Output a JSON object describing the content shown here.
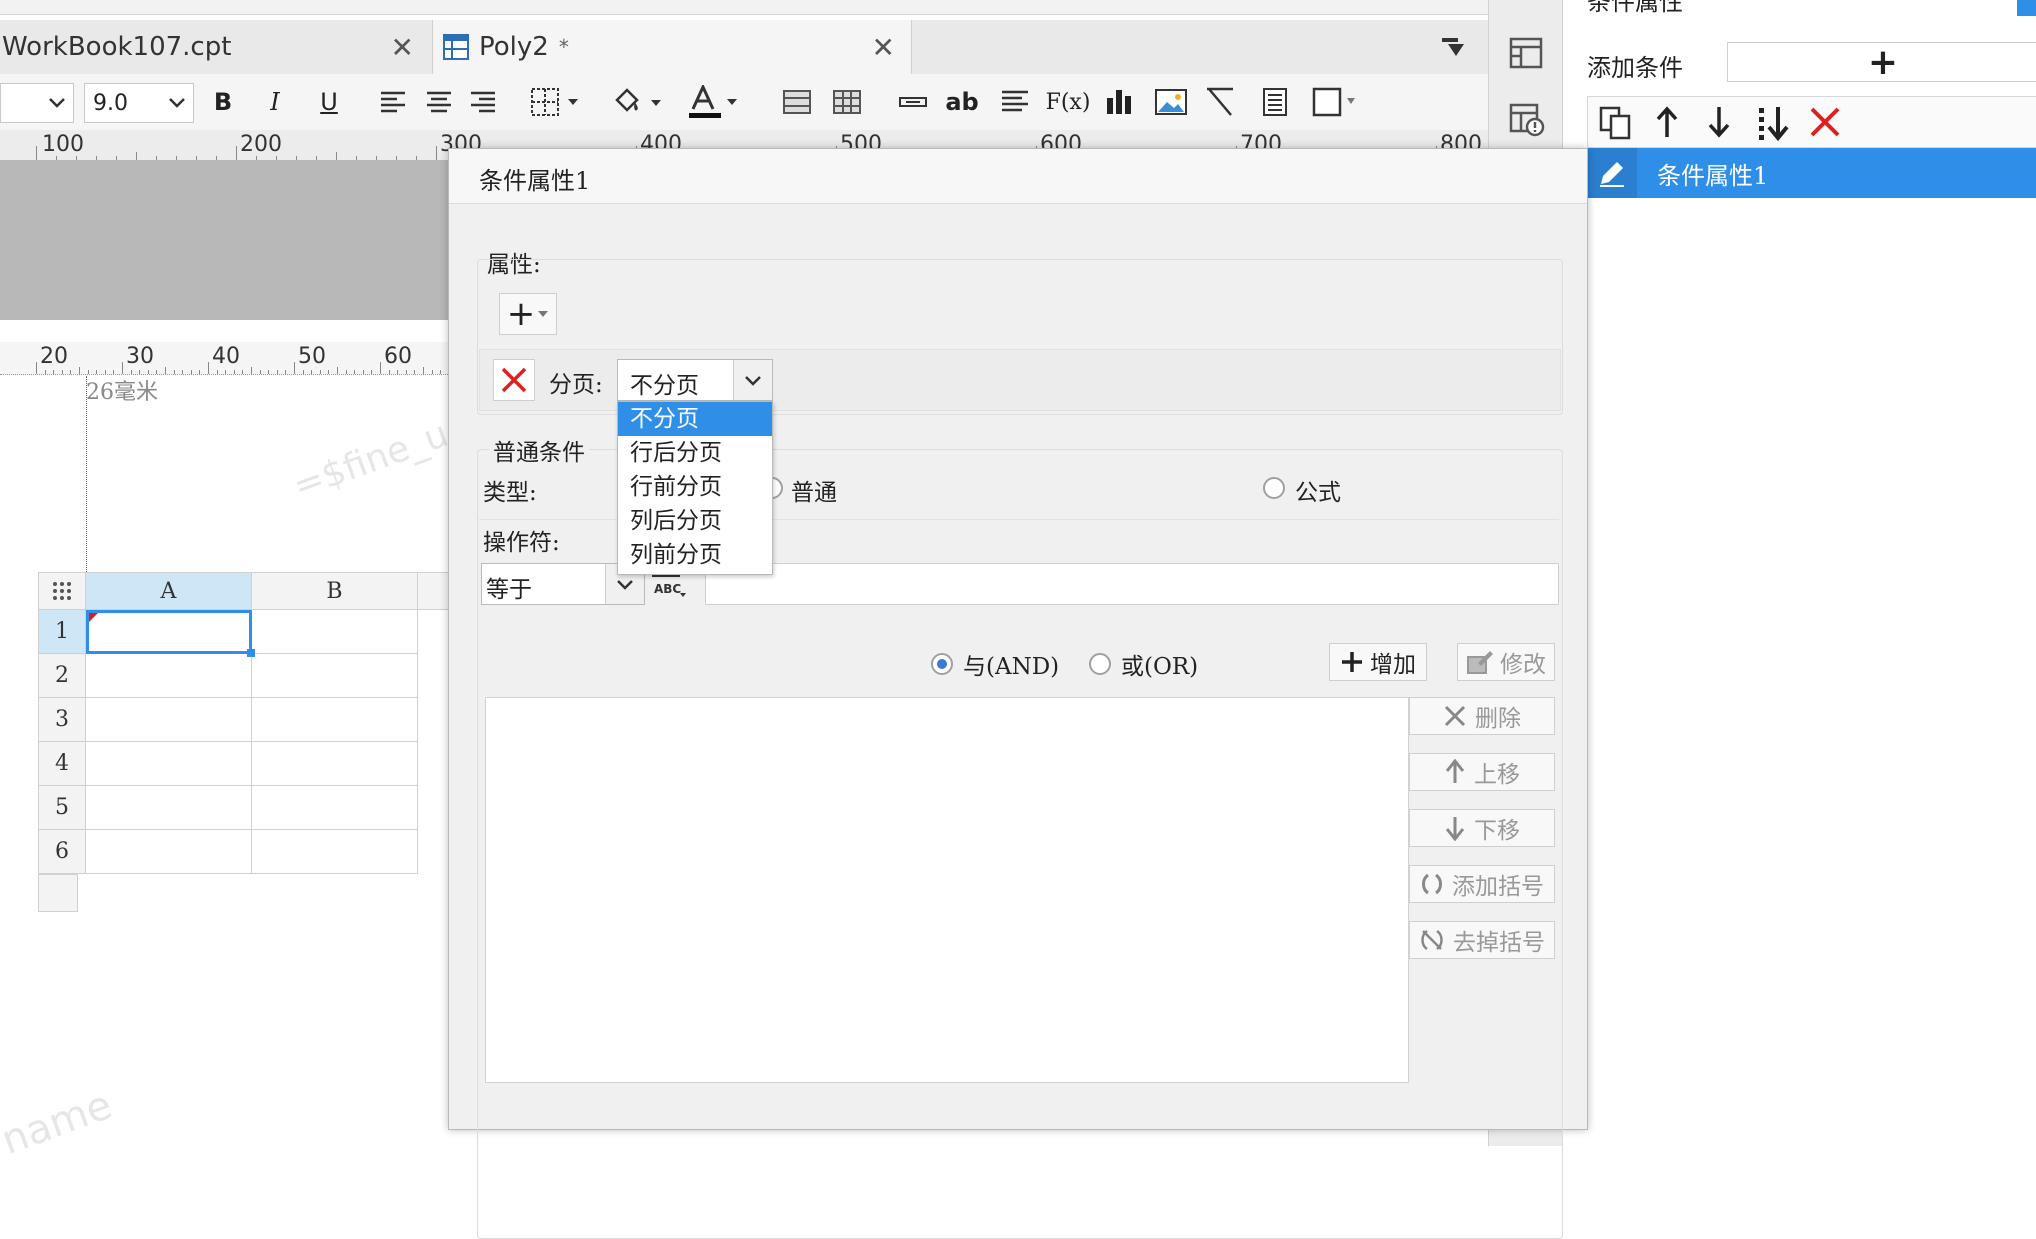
{
  "tabs": [
    {
      "label": "WorkBook107.cpt",
      "close": "✕"
    },
    {
      "label": "Poly2",
      "modified": "*",
      "close": "✕"
    }
  ],
  "toolbar": {
    "font_size": "9.0",
    "bold": "B",
    "italic": "I",
    "underline": "U",
    "text_tool": "ab",
    "formula_tool": "F(x)"
  },
  "top_ruler": [
    "100",
    "200",
    "300",
    "400",
    "500",
    "600",
    "700",
    "800"
  ],
  "bottom_ruler": [
    "20",
    "30",
    "40",
    "50",
    "60"
  ],
  "margin_note": "26毫米",
  "watermarks": [
    "=$fine_u",
    "name"
  ],
  "sheet": {
    "columns": [
      "A",
      "B"
    ],
    "rows": [
      "1",
      "2",
      "3",
      "4",
      "5",
      "6"
    ]
  },
  "right_panel": {
    "header": "条件属性",
    "add_condition_label": "添加条件",
    "add_symbol": "+",
    "selected_item": "条件属性1"
  },
  "dialog": {
    "title": "条件属性1",
    "property_label": "属性:",
    "add_symbol": "+",
    "pagination_label": "分页:",
    "pagination_value": "不分页",
    "pagination_options": [
      "不分页",
      "行后分页",
      "行前分页",
      "列后分页",
      "列前分页"
    ],
    "selected_option_index": 0,
    "normal_condition_label": "普通条件",
    "type_label": "类型:",
    "type_options": [
      "普通",
      "公式"
    ],
    "operator_label": "操作符:",
    "operator_value": "等于",
    "and_label": "与(AND)",
    "or_label": "或(OR)",
    "and_selected": true,
    "add_button": "增加",
    "modify_button": "修改",
    "delete_button": "删除",
    "up_button": "上移",
    "down_button": "下移",
    "add_bracket_button": "添加括号",
    "remove_bracket_button": "去掉括号"
  },
  "colors": {
    "accent": "#3a7bd5",
    "selection": "#2f8fe8",
    "delete_red": "#e02020",
    "header_highlight": "#cfe6f7"
  }
}
